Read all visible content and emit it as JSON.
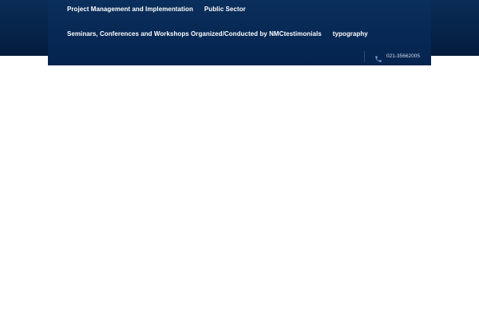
{
  "nav": {
    "items": [
      {
        "label": "Project Management and Implementation"
      },
      {
        "label": "Public Sector"
      },
      {
        "label": "Seminars, Conferences and Workshops Organized/Conducted by NMC"
      },
      {
        "label": "testimonials"
      },
      {
        "label": "typography"
      }
    ]
  },
  "contact": {
    "phone": "021-35662005",
    "icon": "phone-icon"
  },
  "colors": {
    "header_bg": "#062448",
    "nav_bg": "#072955",
    "nav_text": "#ffffff",
    "phone_icon": "#6f9fd8"
  }
}
